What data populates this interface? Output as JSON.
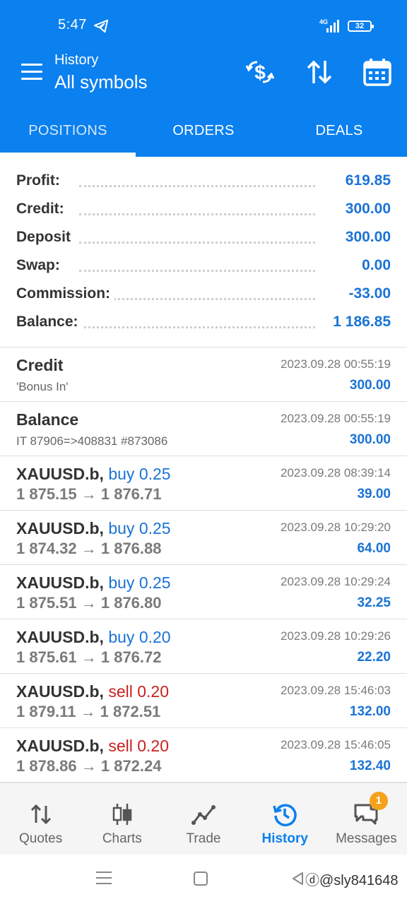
{
  "status": {
    "time": "5:47",
    "network": "4G",
    "battery": "32"
  },
  "header": {
    "subtitle": "History",
    "title": "All symbols"
  },
  "tabs": [
    {
      "label": "POSITIONS",
      "active": true
    },
    {
      "label": "ORDERS",
      "active": false
    },
    {
      "label": "DEALS",
      "active": false
    }
  ],
  "summary": [
    {
      "label": "Profit:",
      "value": "619.85"
    },
    {
      "label": "Credit:",
      "value": "300.00"
    },
    {
      "label": "Deposit",
      "value": "300.00"
    },
    {
      "label": "Swap:",
      "value": "0.00"
    },
    {
      "label": "Commission:",
      "value": "-33.00"
    },
    {
      "label": "Balance:",
      "value": "1 186.85"
    }
  ],
  "items": [
    {
      "kind": "op",
      "title": "Credit",
      "sub": "'Bonus In'",
      "date": "2023.09.28 00:55:19",
      "amount": "300.00"
    },
    {
      "kind": "op",
      "title": "Balance",
      "sub": "IT 87906=>408831 #873086",
      "date": "2023.09.28 00:55:19",
      "amount": "300.00"
    },
    {
      "kind": "trade",
      "symbol": "XAUUSD.b,",
      "dir": "buy",
      "dir_text": "buy 0.25",
      "prices": "1 875.15 → 1 876.71",
      "date": "2023.09.28 08:39:14",
      "amount": "39.00"
    },
    {
      "kind": "trade",
      "symbol": "XAUUSD.b,",
      "dir": "buy",
      "dir_text": "buy 0.25",
      "prices": "1 874.32 → 1 876.88",
      "date": "2023.09.28 10:29:20",
      "amount": "64.00"
    },
    {
      "kind": "trade",
      "symbol": "XAUUSD.b,",
      "dir": "buy",
      "dir_text": "buy 0.25",
      "prices": "1 875.51 → 1 876.80",
      "date": "2023.09.28 10:29:24",
      "amount": "32.25"
    },
    {
      "kind": "trade",
      "symbol": "XAUUSD.b,",
      "dir": "buy",
      "dir_text": "buy 0.20",
      "prices": "1 875.61 → 1 876.72",
      "date": "2023.09.28 10:29:26",
      "amount": "22.20"
    },
    {
      "kind": "trade",
      "symbol": "XAUUSD.b,",
      "dir": "sell",
      "dir_text": "sell 0.20",
      "prices": "1 879.11 → 1 872.51",
      "date": "2023.09.28 15:46:03",
      "amount": "132.00"
    },
    {
      "kind": "trade",
      "symbol": "XAUUSD.b,",
      "dir": "sell",
      "dir_text": "sell 0.20",
      "prices": "1 878.86 → 1 872.24",
      "date": "2023.09.28 15:46:05",
      "amount": "132.40"
    }
  ],
  "bottom_nav": [
    {
      "label": "Quotes",
      "icon": "quotes-icon",
      "active": false
    },
    {
      "label": "Charts",
      "icon": "charts-icon",
      "active": false
    },
    {
      "label": "Trade",
      "icon": "trade-icon",
      "active": false
    },
    {
      "label": "History",
      "icon": "history-icon",
      "active": true
    },
    {
      "label": "Messages",
      "icon": "messages-icon",
      "active": false,
      "badge": "1"
    }
  ],
  "watermark": "ⓓ@sly841648",
  "colors": {
    "primary": "#0b80ef",
    "value_blue": "#1a73d6",
    "sell_red": "#cc1f1f",
    "badge_orange": "#f4a11c"
  }
}
